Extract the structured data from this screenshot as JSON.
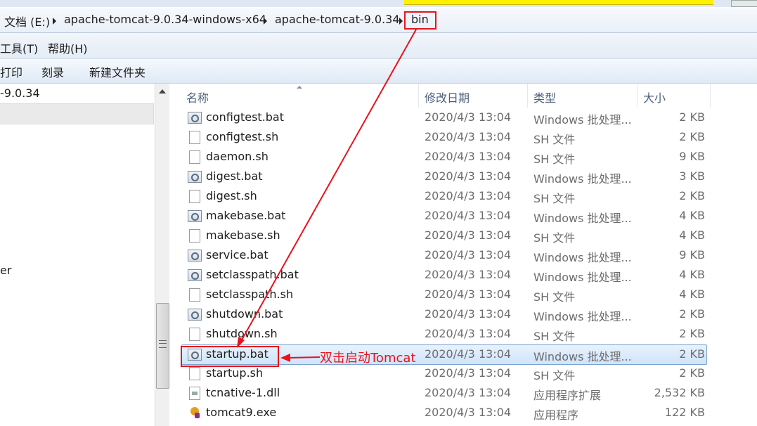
{
  "address_bar": {
    "crumbs": [
      "文档 (E:)",
      "apache-tomcat-9.0.34-windows-x64",
      "apache-tomcat-9.0.34",
      "bin"
    ]
  },
  "menu": {
    "items": [
      "工具(T)",
      "帮助(H)"
    ]
  },
  "toolbar": {
    "items": [
      "打印",
      "刻录",
      "新建文件夹"
    ]
  },
  "nav_pane": {
    "folder_label": "-9.0.34",
    "partial_label": "er"
  },
  "columns": {
    "name": "名称",
    "date": "修改日期",
    "type": "类型",
    "size": "大小"
  },
  "files": [
    {
      "name": "configtest.bat",
      "date": "2020/4/3 13:04",
      "type": "Windows 批处理...",
      "size": "2 KB",
      "icon": "batch-file-icon"
    },
    {
      "name": "configtest.sh",
      "date": "2020/4/3 13:04",
      "type": "SH 文件",
      "size": "2 KB",
      "icon": "blank-file-icon"
    },
    {
      "name": "daemon.sh",
      "date": "2020/4/3 13:04",
      "type": "SH 文件",
      "size": "9 KB",
      "icon": "blank-file-icon"
    },
    {
      "name": "digest.bat",
      "date": "2020/4/3 13:04",
      "type": "Windows 批处理...",
      "size": "3 KB",
      "icon": "batch-file-icon"
    },
    {
      "name": "digest.sh",
      "date": "2020/4/3 13:04",
      "type": "SH 文件",
      "size": "2 KB",
      "icon": "blank-file-icon"
    },
    {
      "name": "makebase.bat",
      "date": "2020/4/3 13:04",
      "type": "Windows 批处理...",
      "size": "4 KB",
      "icon": "batch-file-icon"
    },
    {
      "name": "makebase.sh",
      "date": "2020/4/3 13:04",
      "type": "SH 文件",
      "size": "4 KB",
      "icon": "blank-file-icon"
    },
    {
      "name": "service.bat",
      "date": "2020/4/3 13:04",
      "type": "Windows 批处理...",
      "size": "9 KB",
      "icon": "batch-file-icon"
    },
    {
      "name": "setclasspath.bat",
      "date": "2020/4/3 13:04",
      "type": "Windows 批处理...",
      "size": "4 KB",
      "icon": "batch-file-icon"
    },
    {
      "name": "setclasspath.sh",
      "date": "2020/4/3 13:04",
      "type": "SH 文件",
      "size": "4 KB",
      "icon": "blank-file-icon"
    },
    {
      "name": "shutdown.bat",
      "date": "2020/4/3 13:04",
      "type": "Windows 批处理...",
      "size": "2 KB",
      "icon": "batch-file-icon"
    },
    {
      "name": "shutdown.sh",
      "date": "2020/4/3 13:04",
      "type": "SH 文件",
      "size": "2 KB",
      "icon": "blank-file-icon"
    },
    {
      "name": "startup.bat",
      "date": "2020/4/3 13:04",
      "type": "Windows 批处理...",
      "size": "2 KB",
      "icon": "batch-file-icon",
      "selected": true
    },
    {
      "name": "startup.sh",
      "date": "2020/4/3 13:04",
      "type": "SH 文件",
      "size": "2 KB",
      "icon": "blank-file-icon"
    },
    {
      "name": "tcnative-1.dll",
      "date": "2020/4/3 13:04",
      "type": "应用程序扩展",
      "size": "2,532 KB",
      "icon": "dll-file-icon"
    },
    {
      "name": "tomcat9.exe",
      "date": "2020/4/3 13:04",
      "type": "应用程序",
      "size": "122 KB",
      "icon": "tomcat-exe-icon"
    }
  ],
  "annotation": {
    "text": "双击启动Tomcat",
    "color": "#e8131b"
  }
}
